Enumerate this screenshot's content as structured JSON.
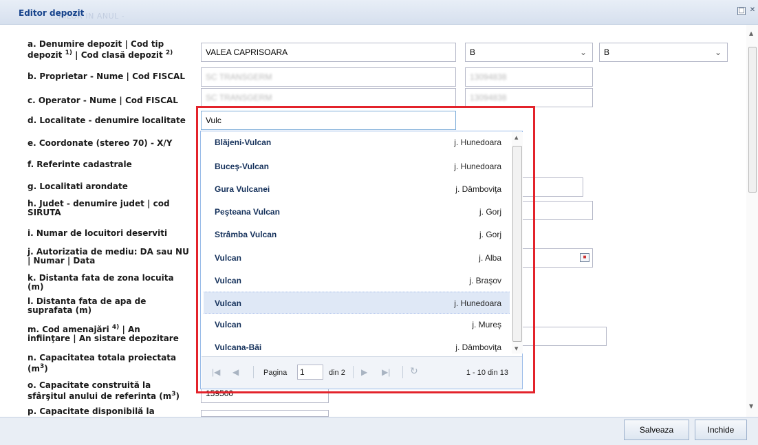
{
  "window": {
    "title": "Editor depozit",
    "ghost_title": "...RILOR IN ANUL -"
  },
  "form": {
    "labels": {
      "a_line1": "a. Denumire depozit | Cod tip",
      "a_line2": "depozit",
      "a_sup1": "1)",
      "a_mid": "| Cod clasă depozit",
      "a_sup2": "2)",
      "b": "b. Proprietar - Nume | Cod FISCAL",
      "c": "c. Operator - Nume | Cod FISCAL",
      "d": "d. Localitate - denumire localitate",
      "e": "e. Coordonate (stereo 70) - X/Y",
      "f": "f. Referinte cadastrale",
      "g": "g. Localitati arondate",
      "h_line1": "h. Judet - denumire judet | cod",
      "h_line2": "SIRUTA",
      "i": "i. Numar de locuitori deserviti",
      "j_line1": "j. Autorizatia de mediu: DA sau NU",
      "j_line2": "| Numar | Data",
      "k_line1": "k. Distanta fata de zona locuita",
      "k_line2": "(m)",
      "l_line1": "l. Distanta fata de apa de",
      "l_line2": "suprafata (m)",
      "m_line1a": "m. Cod amenajări",
      "m_sup": "4)",
      "m_line1b": "| An",
      "m_line2": "infiinţare | An sistare depozitare",
      "n_line1": "n. Capacitatea totala proiectata",
      "n_line2": "(m",
      "n_sup": "3",
      "n_line2b": ")",
      "o_line1": "o. Capacitate construită la",
      "o_line2": "sfârşitul anului de referinta (m",
      "o_sup": "3",
      "o_line2b": ")",
      "p_line1": "p. Capacitate disponibilă la"
    },
    "values": {
      "denumire_depozit": "VALEA CAPRISOARA",
      "cod_tip_depozit": "B",
      "cod_clasa_depozit": "B",
      "proprietar_nume": "SC TRANSGERM",
      "proprietar_cod_fiscal": "13094838",
      "operator_nume": "SC TRANSGERM",
      "operator_cod_fiscal": "13094838",
      "localitate": "Vulc",
      "capacitate_construita": "159500"
    }
  },
  "dropdown": {
    "items": [
      {
        "name": "Blăjeni-Vulcan",
        "county": "j. Hunedoara"
      },
      {
        "name": "Buceş-Vulcan",
        "county": "j. Hunedoara"
      },
      {
        "name": "Gura Vulcanei",
        "county": "j. Dâmboviţa"
      },
      {
        "name": "Peşteana Vulcan",
        "county": "j. Gorj"
      },
      {
        "name": "Strâmba Vulcan",
        "county": "j. Gorj"
      },
      {
        "name": "Vulcan",
        "county": "j. Alba"
      },
      {
        "name": "Vulcan",
        "county": "j. Braşov"
      },
      {
        "name": "Vulcan",
        "county": "j. Hunedoara"
      },
      {
        "name": "Vulcan",
        "county": "j. Mureş"
      },
      {
        "name": "Vulcana-Băi",
        "county": "j. Dâmboviţa"
      }
    ],
    "selected_index": 7,
    "pager": {
      "page_label": "Pagina",
      "page_value": "1",
      "of_label": "din 2",
      "summary": "1 - 10 din 13"
    }
  },
  "buttons": {
    "save": "Salveaza",
    "close": "Inchide"
  },
  "colors": {
    "highlight": "#e3232b",
    "title_text": "#15428b",
    "selected_row": "#dfe8f6"
  },
  "icons": {
    "first_page": "first-page-icon",
    "prev_page": "prev-page-icon",
    "next_page": "next-page-icon",
    "last_page": "last-page-icon",
    "refresh": "refresh-icon",
    "calendar": "calendar-icon",
    "restore": "restore-window-icon",
    "close": "close-window-icon"
  }
}
